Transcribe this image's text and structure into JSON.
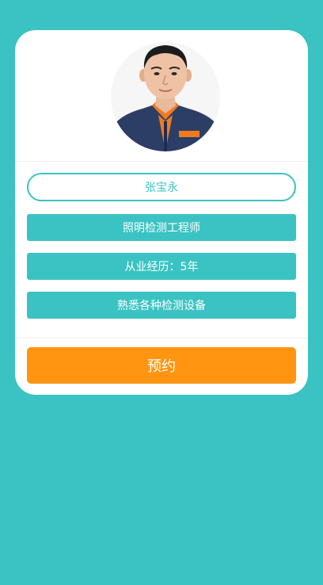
{
  "profile": {
    "name": "张宝永",
    "title": "照明检测工程师",
    "experience": "从业经历：5年",
    "skill": "熟悉各种检测设备"
  },
  "actions": {
    "book_label": "预约"
  },
  "colors": {
    "background": "#3bc3c3",
    "accent": "#3bc3c3",
    "book_button": "#ff9511",
    "card": "#ffffff"
  }
}
